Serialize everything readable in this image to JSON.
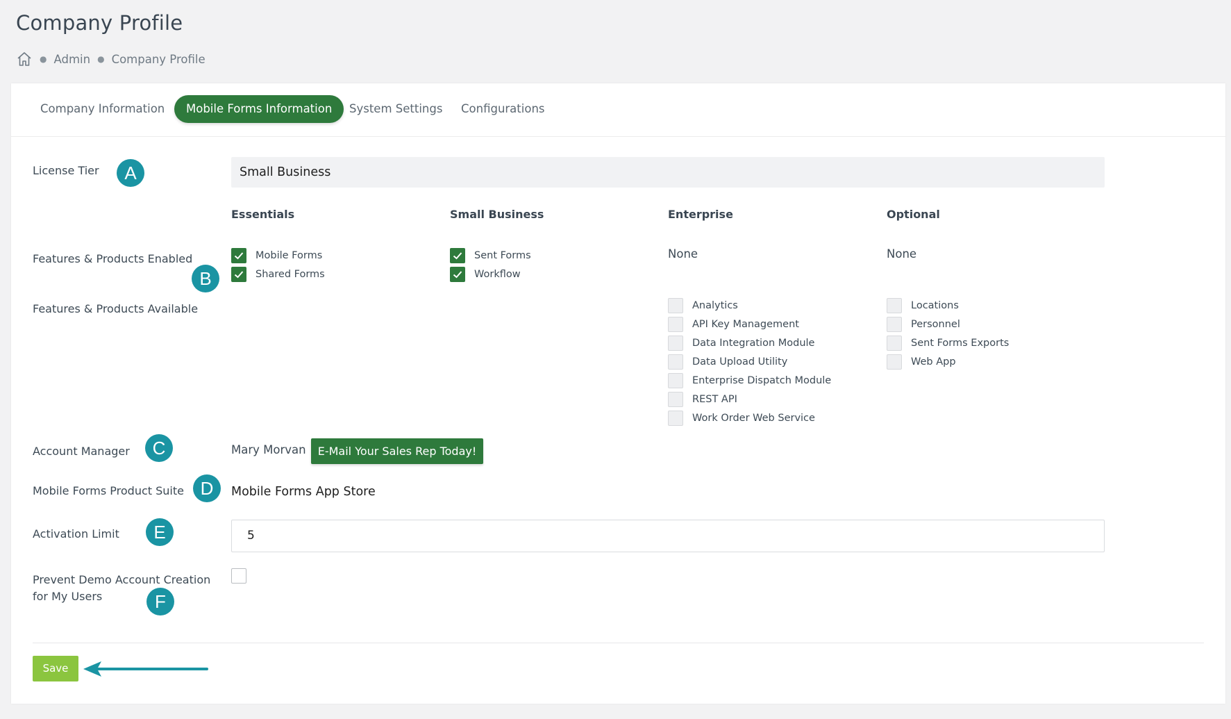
{
  "page": {
    "title": "Company Profile",
    "breadcrumb": [
      "Admin",
      "Company Profile"
    ]
  },
  "tabs": [
    {
      "label": "Company Information",
      "active": false
    },
    {
      "label": "Mobile Forms Information",
      "active": true
    },
    {
      "label": "System Settings",
      "active": false
    },
    {
      "label": "Configurations",
      "active": false
    }
  ],
  "license": {
    "label": "License Tier",
    "value": "Small Business",
    "badge": "A"
  },
  "columns": [
    "Essentials",
    "Small Business",
    "Enterprise",
    "Optional"
  ],
  "features_enabled": {
    "label": "Features & Products Enabled",
    "badge": "B",
    "essentials": [
      "Mobile Forms",
      "Shared Forms"
    ],
    "small_business": [
      "Sent Forms",
      "Workflow"
    ],
    "enterprise": "None",
    "optional": "None"
  },
  "features_available": {
    "label": "Features & Products Available",
    "enterprise": [
      "Analytics",
      "API Key Management",
      "Data Integration Module",
      "Data Upload Utility",
      "Enterprise Dispatch Module",
      "REST API",
      "Work Order Web Service"
    ],
    "optional": [
      "Locations",
      "Personnel",
      "Sent Forms Exports",
      "Web App"
    ]
  },
  "account_manager": {
    "label": "Account Manager",
    "name": "Mary Morvan",
    "button": "E-Mail Your Sales Rep Today!",
    "badge": "C"
  },
  "product_suite": {
    "label": "Mobile Forms Product Suite",
    "value": "Mobile Forms App Store",
    "badge": "D"
  },
  "activation_limit": {
    "label": "Activation Limit",
    "value": "5",
    "badge": "E"
  },
  "prevent_demo": {
    "label_line1": "Prevent Demo Account Creation",
    "label_line2": "for My Users",
    "checked": false,
    "badge": "F"
  },
  "save_label": "Save",
  "colors": {
    "primary_green": "#2e7a3c",
    "save_green": "#8bc53f",
    "badge_teal": "#1a94a3",
    "arrow_teal": "#1a94a3"
  }
}
